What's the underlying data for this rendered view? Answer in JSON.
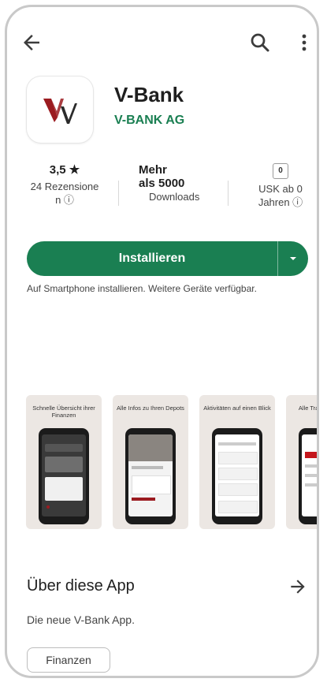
{
  "app": {
    "name": "V-Bank",
    "developer": "V-BANK AG",
    "icon": "v-bank-logo",
    "brand_colors": {
      "green": "#1a7f52",
      "red": "#9b1b20"
    }
  },
  "toolbar": {
    "back_icon": "arrow-left-icon",
    "search_icon": "search-icon",
    "more_icon": "more-vert-icon"
  },
  "stats": {
    "rating": {
      "value": "3,5 ★",
      "label_line1": "24 Rezensione",
      "label_line2": "n ⓘ"
    },
    "downloads": {
      "value_line1": "Mehr",
      "value_line2": "als 5000",
      "label": "Downloads"
    },
    "age": {
      "badge": "0",
      "label_line1": "USK ab 0",
      "label_line2": "Jahren ⓘ"
    }
  },
  "install": {
    "label": "Installieren",
    "note": "Auf Smartphone installieren. Weitere Geräte verfügbar."
  },
  "screenshots": [
    {
      "caption": "Schnelle Übersicht ihrer Finanzen"
    },
    {
      "caption": "Alle Infos zu Ihren Depots"
    },
    {
      "caption": "Aktivitäten auf einen Blick"
    },
    {
      "caption": "Alle Trans an einen"
    }
  ],
  "about": {
    "title": "Über diese App",
    "description": "Die neue V-Bank App.",
    "category_chip": "Finanzen"
  }
}
